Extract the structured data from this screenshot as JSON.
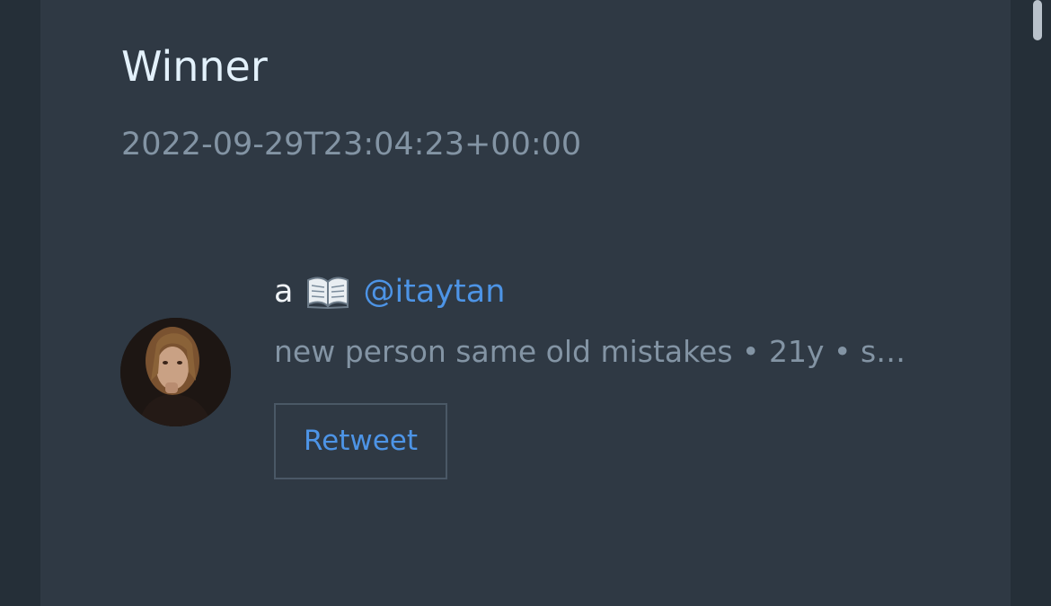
{
  "post": {
    "title": "Winner",
    "timestamp": "2022-09-29T23:04:23+00:00"
  },
  "user": {
    "display_name": "a",
    "name_emoji": "book-icon",
    "handle": "@itaytan",
    "bio": "new person same old mistakes • 21y • s…"
  },
  "actions": {
    "retweet_label": "Retweet"
  },
  "colors": {
    "background": "#252f38",
    "card": "#2f3944",
    "link": "#4d94e6",
    "muted_text": "#8394a4",
    "title_text": "#e3f1fb"
  }
}
